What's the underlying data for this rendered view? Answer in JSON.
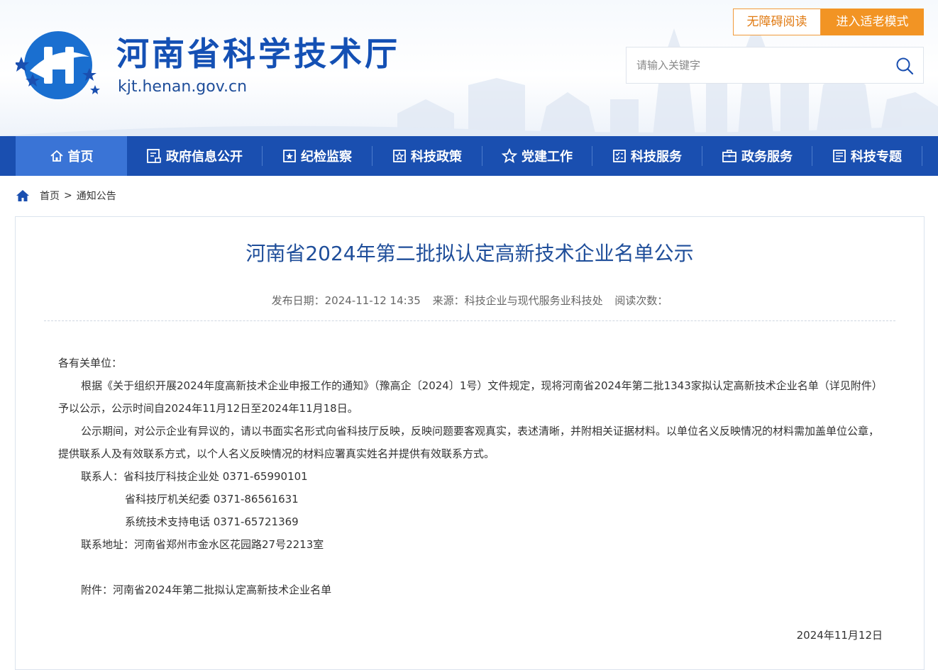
{
  "header": {
    "site_title": "河南省科学技术厅",
    "site_url": "kjt.henan.gov.cn",
    "accessibility_label": "无障碍阅读",
    "elder_mode_label": "进入适老模式",
    "search_placeholder": "请输入关键字"
  },
  "nav": {
    "items": [
      {
        "label": "首页",
        "icon": "home-icon"
      },
      {
        "label": "政府信息公开",
        "icon": "info-disclosure-icon"
      },
      {
        "label": "纪检监察",
        "icon": "inspection-icon"
      },
      {
        "label": "科技政策",
        "icon": "policy-icon"
      },
      {
        "label": "党建工作",
        "icon": "star-icon"
      },
      {
        "label": "科技服务",
        "icon": "checklist-icon"
      },
      {
        "label": "政务服务",
        "icon": "briefcase-icon"
      },
      {
        "label": "科技专题",
        "icon": "document-icon"
      }
    ],
    "active_index": 0
  },
  "breadcrumb": {
    "home": "首页",
    "separator": ">",
    "current": "通知公告"
  },
  "article": {
    "title": "河南省2024年第二批拟认定高新技术企业名单公示",
    "meta": {
      "publish_date": "发布日期：2024-11-12 14:35",
      "source": "来源：科技企业与现代服务业科技处",
      "views": "阅读次数："
    },
    "salutation": "各有关单位：",
    "paragraph1": "根据《关于组织开展2024年度高新技术企业申报工作的通知》（豫高企〔2024〕1号）文件规定，现将河南省2024年第二批1343家拟认定高新技术企业名单（详见附件）予以公示，公示时间自2024年11月12日至2024年11月18日。",
    "paragraph2": "公示期间，对公示企业有异议的，请以书面实名形式向省科技厅反映，反映问题要客观真实，表述清晰，并附相关证据材料。以单位名义反映情况的材料需加盖单位公章，提供联系人及有效联系方式，以个人名义反映情况的材料应署真实姓名并提供有效联系方式。",
    "contact1": "联系人：省科技厅科技企业处 0371-65990101",
    "contact2": "省科技厅机关纪委 0371-86561631",
    "contact3": "系统技术支持电话 0371-65721369",
    "address": "联系地址：河南省郑州市金水区花园路27号2213室",
    "attachment": "附件：河南省2024年第二批拟认定高新技术企业名单",
    "date": "2024年11月12日"
  },
  "colors": {
    "brand_blue": "#1a4fb0",
    "active_tab": "#3a74d6",
    "title_blue": "#1f4e9a",
    "orange": "#f29424"
  }
}
